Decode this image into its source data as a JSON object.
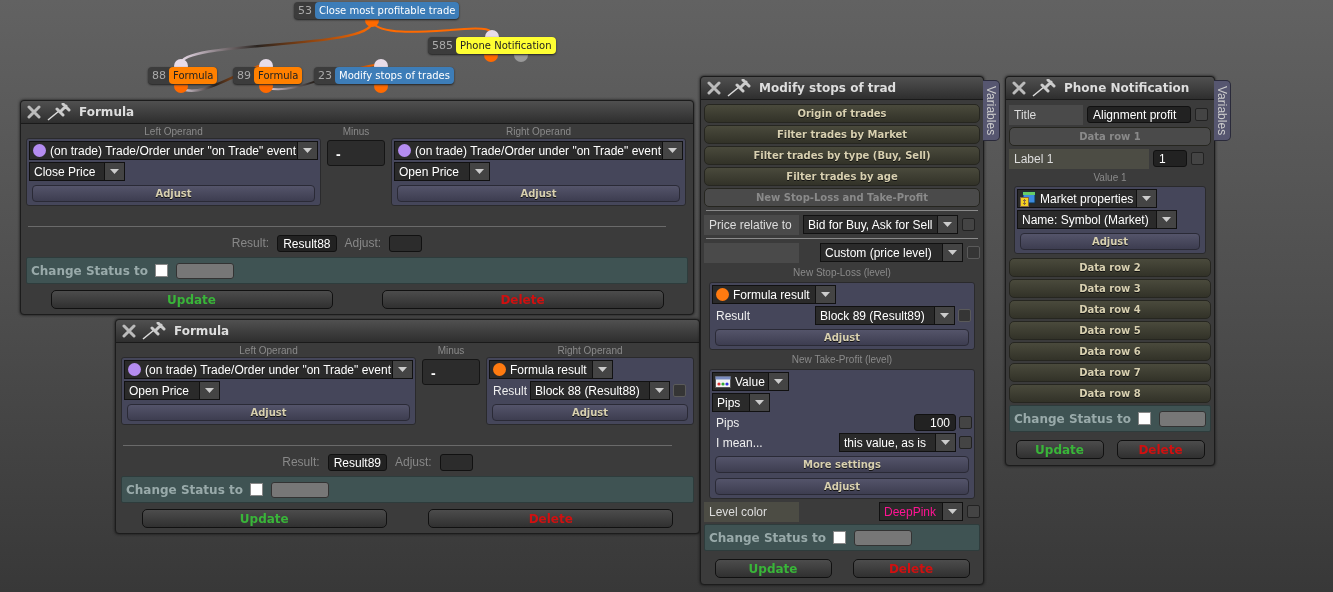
{
  "canvas": {
    "nodes": [
      {
        "id": "53",
        "label": "Close most profitable trade",
        "color": "#3d7db8"
      },
      {
        "id": "585",
        "label": "Phone Notification",
        "color": "#ffff33"
      },
      {
        "id": "88",
        "label": "Formula",
        "color": "#ff8000"
      },
      {
        "id": "89",
        "label": "Formula",
        "color": "#ff8000"
      },
      {
        "id": "23",
        "label": "Modify stops of trades",
        "color": "#3d7db8"
      }
    ]
  },
  "formula_windows": [
    {
      "title": "Formula",
      "left": {
        "caption": "Left Operand",
        "kind": "trade",
        "source": "(on trade) Trade/Order under \"on Trade\" event",
        "field": "Close Price",
        "adjust": "Adjust"
      },
      "operator_caption": "Minus",
      "operator": "-",
      "right": {
        "caption": "Right Operand",
        "kind": "trade",
        "source": "(on trade) Trade/Order under \"on Trade\" event",
        "field": "Open Price",
        "adjust": "Adjust"
      },
      "result_label": "Result:",
      "result": "Result88",
      "adjust_label": "Adjust:",
      "status": {
        "label": "Change Status to",
        "checked": false
      },
      "update": "Update",
      "delete": "Delete"
    },
    {
      "title": "Formula",
      "left": {
        "caption": "Left Operand",
        "kind": "trade",
        "source": "(on trade) Trade/Order under \"on Trade\" event",
        "field": "Open Price",
        "adjust": "Adjust"
      },
      "operator_caption": "Minus",
      "operator": "-",
      "right": {
        "caption": "Right Operand",
        "kind": "formula",
        "source": "Formula result",
        "result_label": "Result",
        "result": "Block 88 (Result88)",
        "result_check": {
          "checked": false,
          "disabled": true
        },
        "adjust": "Adjust"
      },
      "result_label": "Result:",
      "result": "Result89",
      "adjust_label": "Adjust:",
      "status": {
        "label": "Change Status to",
        "checked": false
      },
      "update": "Update",
      "delete": "Delete"
    }
  ],
  "modify_window": {
    "title": "Modify stops of trad",
    "tab": "Variables",
    "sections": [
      {
        "label": "Origin of trades",
        "expanded": false
      },
      {
        "label": "Filter trades by Market",
        "expanded": false
      },
      {
        "label": "Filter trades by type (Buy, Sell)",
        "expanded": false
      },
      {
        "label": "Filter trades by age",
        "expanded": false
      },
      {
        "label": "New Stop-Loss and Take-Profit",
        "expanded": true
      }
    ],
    "price_relative": {
      "label": "Price relative to",
      "value": "Bid for Buy, Ask for Sell",
      "check": {
        "checked": false,
        "disabled": false
      }
    },
    "level_type": {
      "value": "Custom (price level)",
      "check": {
        "checked": false,
        "disabled": true
      }
    },
    "stop_loss": {
      "caption": "New Stop-Loss (level)",
      "source": "Formula result",
      "result_label": "Result",
      "result": "Block 89 (Result89)",
      "check": {
        "checked": false,
        "disabled": true
      },
      "adjust": "Adjust"
    },
    "take_profit": {
      "caption": "New Take-Profit (level)",
      "source": "Value",
      "unit": "Pips",
      "pips_label": "Pips",
      "pips": "100",
      "pips_check": {
        "checked": false,
        "disabled": false
      },
      "mean_label": "I mean...",
      "mean": "this value, as is",
      "mean_check": {
        "checked": false,
        "disabled": false
      },
      "more": "More settings",
      "adjust": "Adjust"
    },
    "level_color": {
      "label": "Level color",
      "value": "DeepPink",
      "color": "#ff1493",
      "check": {
        "checked": false,
        "disabled": false
      }
    },
    "status": {
      "label": "Change Status to",
      "checked": false
    },
    "update": "Update",
    "delete": "Delete"
  },
  "phone_window": {
    "title": "Phone Notification",
    "tab": "Variables",
    "title_row": {
      "label": "Title",
      "value": "Alignment profit",
      "check": {
        "checked": false,
        "disabled": false
      }
    },
    "data_rows": [
      {
        "label": "Data row 1",
        "expanded": true,
        "name_label": "Label 1",
        "name_value": "1",
        "check": {
          "checked": false,
          "disabled": false
        },
        "value_caption": "Value 1",
        "source": "Market properties",
        "field": "Name: Symbol (Market)",
        "adjust": "Adjust"
      },
      {
        "label": "Data row 2",
        "expanded": false
      },
      {
        "label": "Data row 3",
        "expanded": false
      },
      {
        "label": "Data row 4",
        "expanded": false
      },
      {
        "label": "Data row 5",
        "expanded": false
      },
      {
        "label": "Data row 6",
        "expanded": false
      },
      {
        "label": "Data row 7",
        "expanded": false
      },
      {
        "label": "Data row 8",
        "expanded": false
      }
    ],
    "status": {
      "label": "Change Status to",
      "checked": false
    },
    "update": "Update",
    "delete": "Delete"
  }
}
